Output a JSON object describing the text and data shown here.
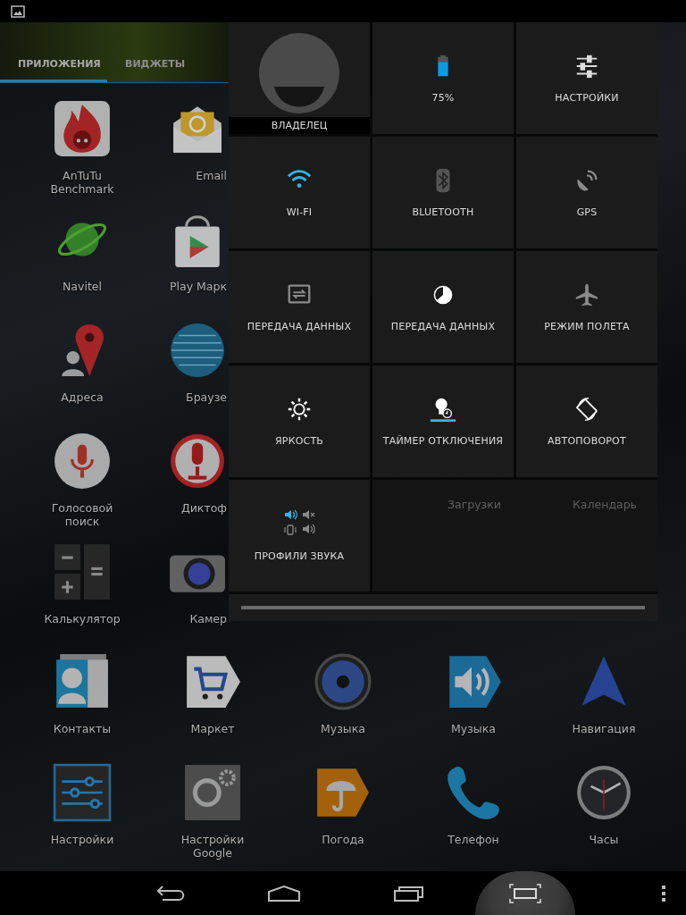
{
  "tabs": [
    {
      "label": "ПРИЛОЖЕНИЯ",
      "selected": true
    },
    {
      "label": "ВИДЖЕТЫ",
      "selected": false
    }
  ],
  "apps_left": [
    {
      "label": "AnTuTu Benchmark",
      "kind": "antutu"
    },
    {
      "label": "Navitel",
      "kind": "navitel"
    },
    {
      "label": "Адреса",
      "kind": "pin"
    },
    {
      "label": "Голосовой поиск",
      "kind": "voice"
    },
    {
      "label": "Калькулятор",
      "kind": "calc"
    }
  ],
  "apps_left_cut": [
    {
      "label": "Email",
      "kind": "email"
    },
    {
      "label": "Play Марк",
      "kind": "play"
    },
    {
      "label": "Браузе",
      "kind": "globe"
    },
    {
      "label": "Диктоф",
      "kind": "recorder"
    },
    {
      "label": "Камер",
      "kind": "camera"
    }
  ],
  "quick_settings": {
    "owner": {
      "label": "ВЛАДЕЛЕЦ"
    },
    "tiles": [
      {
        "kind": "battery",
        "label": "75%"
      },
      {
        "kind": "settings",
        "label": "НАСТРОЙКИ"
      },
      {
        "kind": "wifi",
        "label": "WI-FI",
        "on": true
      },
      {
        "kind": "bluetooth",
        "label": "BLUETOOTH",
        "on": false
      },
      {
        "kind": "gps",
        "label": "GPS",
        "on": false
      },
      {
        "kind": "data",
        "label": "ПЕРЕДАЧА ДАННЫХ",
        "on": false
      },
      {
        "kind": "usage",
        "label": "ПЕРЕДАЧА ДАННЫХ"
      },
      {
        "kind": "airplane",
        "label": "РЕЖИМ ПОЛЕТА",
        "on": false
      },
      {
        "kind": "brightness",
        "label": "ЯРКОСТЬ"
      },
      {
        "kind": "timer",
        "label": "ТАЙМЕР ОТКЛЮЧЕНИЯ"
      },
      {
        "kind": "rotate",
        "label": "АВТОПОВОРОТ"
      },
      {
        "kind": "sound",
        "label": "ПРОФИЛИ ЗВУКА"
      }
    ],
    "apps_behind": [
      {
        "label": "Загрузки"
      },
      {
        "label": "Календарь"
      }
    ]
  },
  "apps_bottom": [
    {
      "label": "Контакты",
      "kind": "contacts"
    },
    {
      "label": "Маркет",
      "kind": "market"
    },
    {
      "label": "Музыка",
      "kind": "speaker"
    },
    {
      "label": "Музыка",
      "kind": "music"
    },
    {
      "label": "Навигация",
      "kind": "navigation"
    },
    {
      "label": "Настройки",
      "kind": "settings"
    },
    {
      "label": "Настройки Google",
      "kind": "gsettings"
    },
    {
      "label": "Погода",
      "kind": "weather"
    },
    {
      "label": "Телефон",
      "kind": "phone"
    },
    {
      "label": "Часы",
      "kind": "clock"
    }
  ]
}
